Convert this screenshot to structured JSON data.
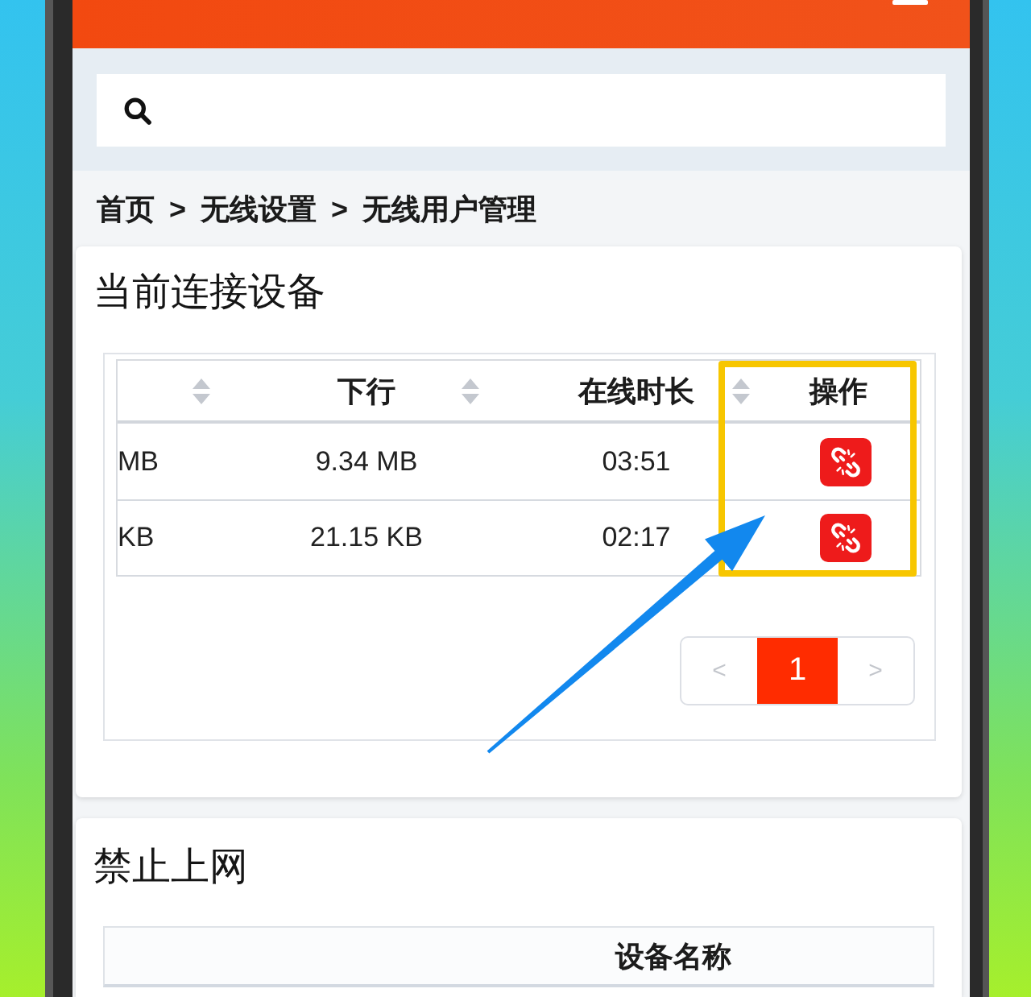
{
  "breadcrumb": [
    {
      "label": "首页",
      "separator": ">"
    },
    {
      "label": "无线设置",
      "separator": ">"
    },
    {
      "label": "无线用户管理"
    }
  ],
  "connected_devices": {
    "title": "当前连接设备",
    "columns": [
      {
        "kind": "text",
        "sortable": true
      },
      {
        "kind": "text",
        "label": "下行",
        "sortable": true
      },
      {
        "kind": "text",
        "label": "在线时长",
        "sortable": true
      },
      {
        "kind": "action",
        "label": "操作",
        "sortable": false
      }
    ],
    "rows": [
      {
        "cells": [
          "MB",
          "9.34 MB",
          "03:51"
        ]
      },
      {
        "cells": [
          "KB",
          "21.15 KB",
          "02:17"
        ]
      }
    ],
    "pagination": {
      "previous": {
        "label": "<",
        "disabled": true
      },
      "pages": [
        {
          "label": "1",
          "selected": true
        }
      ],
      "next": {
        "label": ">",
        "disabled": true
      }
    }
  },
  "blocked_devices": {
    "title": "禁止上网",
    "columns": [
      "设备名称"
    ]
  }
}
